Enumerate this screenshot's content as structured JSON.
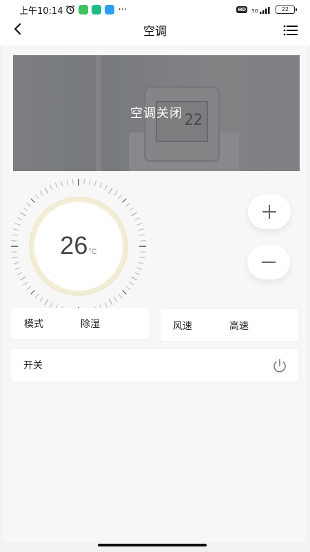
{
  "statusbar": {
    "time": "上午10:14",
    "more": "···",
    "hd": "HD",
    "network": "5G",
    "battery": "22",
    "app_icon_colors": [
      "#3cc35d",
      "#1cbc87",
      "#2a9df4"
    ]
  },
  "nav": {
    "title": "空调",
    "back_icon": "chevron-left-icon",
    "menu_icon": "list-menu-icon"
  },
  "banner": {
    "status": "空调关闭",
    "device_reading": "22"
  },
  "dial": {
    "temperature": "26",
    "unit": "°C"
  },
  "controls": {
    "increase_icon": "plus-icon",
    "decrease_icon": "minus-icon"
  },
  "mode": {
    "label": "模式",
    "value": "除湿"
  },
  "fan": {
    "label": "风速",
    "value": "高速"
  },
  "power": {
    "label": "开关",
    "icon": "power-icon"
  },
  "colors": {
    "background": "#f7f7f7",
    "card": "#ffffff",
    "dial_glow": "#f4f0dc"
  }
}
